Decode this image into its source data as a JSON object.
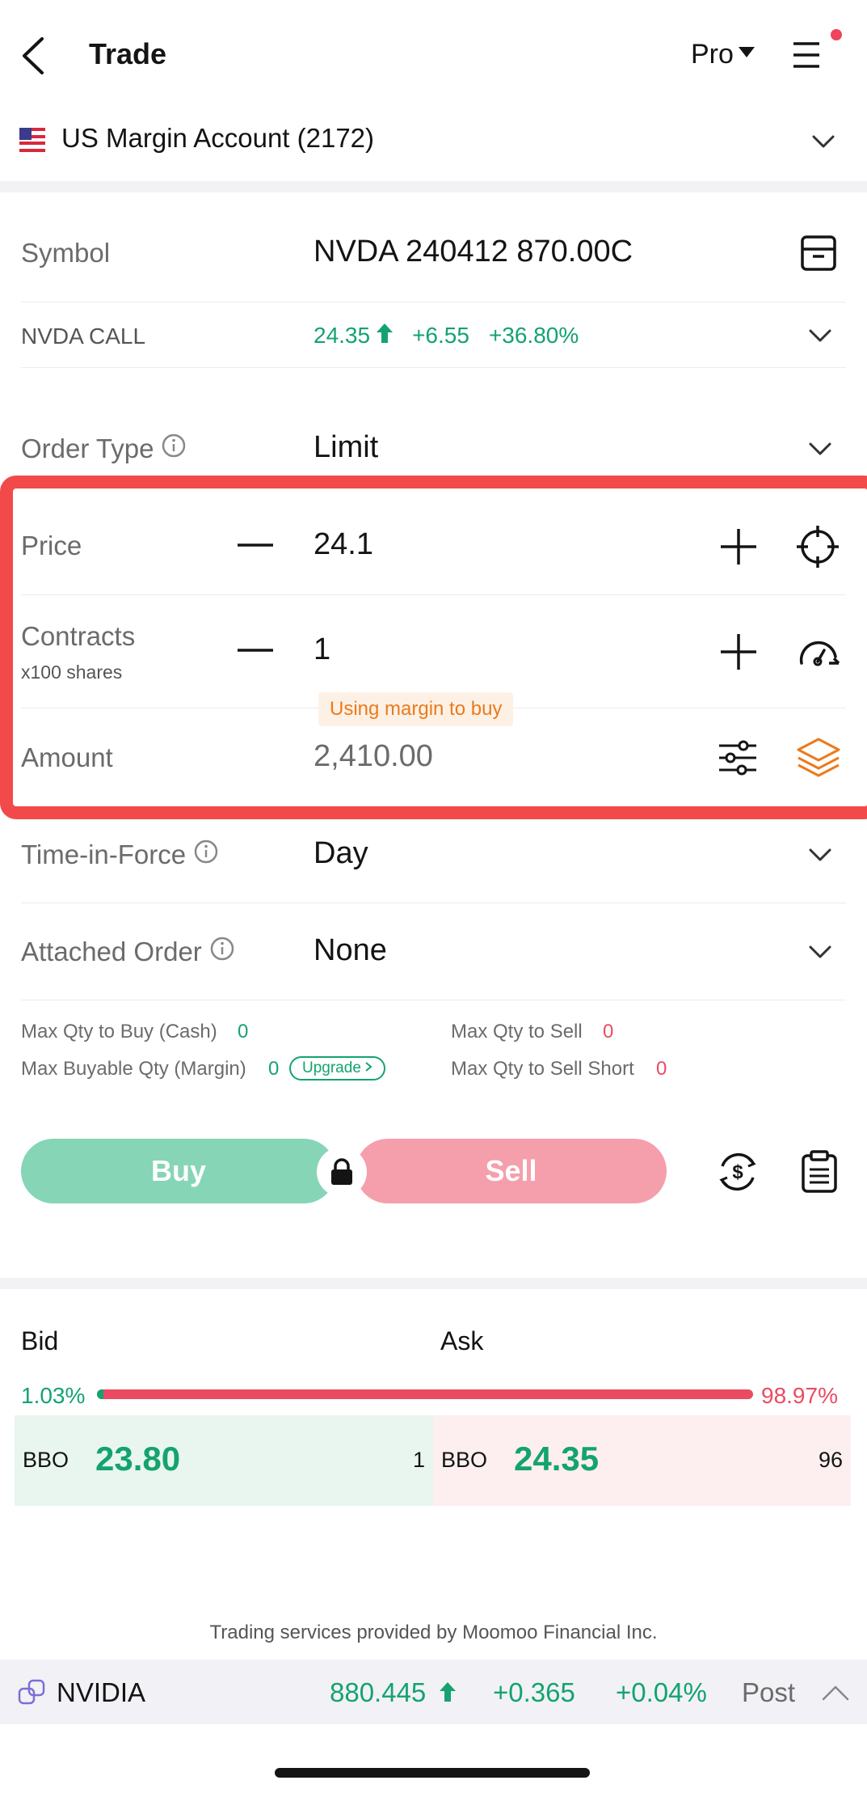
{
  "header": {
    "title": "Trade",
    "mode_label": "Pro",
    "notification_dot_color": "#f0435c"
  },
  "account": {
    "flag_icon": "us-flag-icon",
    "name": "US Margin Account (2172)"
  },
  "symbol": {
    "label": "Symbol",
    "value": "NVDA 240412 870.00C",
    "sub_label": "NVDA CALL",
    "price": "24.35",
    "change": "+6.55",
    "change_pct": "+36.80%"
  },
  "order_type": {
    "label": "Order Type",
    "value": "Limit"
  },
  "price": {
    "label": "Price",
    "value": "24.1"
  },
  "contracts": {
    "label": "Contracts",
    "sub_label": "x100 shares",
    "value": "1"
  },
  "amount": {
    "label": "Amount",
    "value": "2,410.00",
    "tooltip": "Using margin to buy"
  },
  "tif": {
    "label": "Time-in-Force",
    "value": "Day"
  },
  "attached": {
    "label": "Attached Order",
    "value": "None"
  },
  "limits": {
    "max_buy_cash_label": "Max Qty to Buy (Cash)",
    "max_buy_cash_value": "0",
    "max_buy_margin_label": "Max Buyable Qty (Margin)",
    "max_buy_margin_value": "0",
    "upgrade_label": "Upgrade",
    "max_sell_label": "Max Qty to Sell",
    "max_sell_value": "0",
    "max_short_label": "Max Qty to Sell Short",
    "max_short_value": "0"
  },
  "actions": {
    "buy_label": "Buy",
    "sell_label": "Sell"
  },
  "book": {
    "bid_label": "Bid",
    "ask_label": "Ask",
    "bid_pct": "1.03%",
    "ask_pct": "98.97%",
    "bid_ratio": 0.0103,
    "bid_bbo_label": "BBO",
    "bid_price": "23.80",
    "bid_size": "1",
    "ask_bbo_label": "BBO",
    "ask_price": "24.35",
    "ask_size": "96"
  },
  "footer": {
    "provider": "Trading services provided by Moomoo Financial Inc."
  },
  "ticker": {
    "name": "NVIDIA",
    "price": "880.445",
    "change": "+0.365",
    "change_pct": "+0.04%",
    "session": "Post"
  },
  "colors": {
    "green": "#14a36f",
    "red": "#ea4b62",
    "orange": "#ec7a1c",
    "highlight": "#f24a4a"
  }
}
